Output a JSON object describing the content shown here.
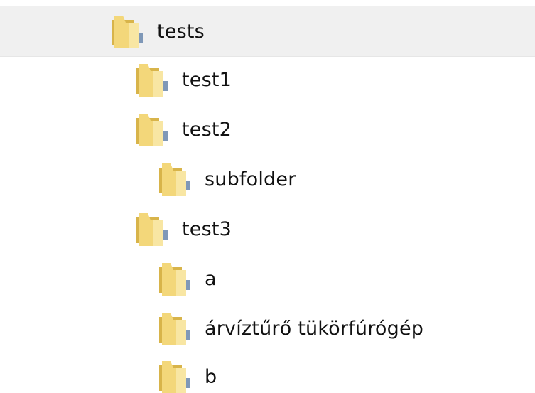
{
  "tree": {
    "items": [
      {
        "label": "tests",
        "icon": "folder-icon",
        "selected": true
      },
      {
        "label": "test1",
        "icon": "folder-icon",
        "selected": false
      },
      {
        "label": "test2",
        "icon": "folder-icon",
        "selected": false
      },
      {
        "label": "subfolder",
        "icon": "folder-icon",
        "selected": false
      },
      {
        "label": "test3",
        "icon": "folder-icon",
        "selected": false
      },
      {
        "label": "a",
        "icon": "folder-icon",
        "selected": false
      },
      {
        "label": "árvíztűrő tükörfúrógép",
        "icon": "folder-icon",
        "selected": false
      },
      {
        "label": "b",
        "icon": "folder-icon",
        "selected": false
      }
    ]
  },
  "colors": {
    "selection_bg": "#f0f0f0",
    "folder_front": "#f3d77a",
    "folder_back": "#d8b44a",
    "text": "#111111"
  }
}
